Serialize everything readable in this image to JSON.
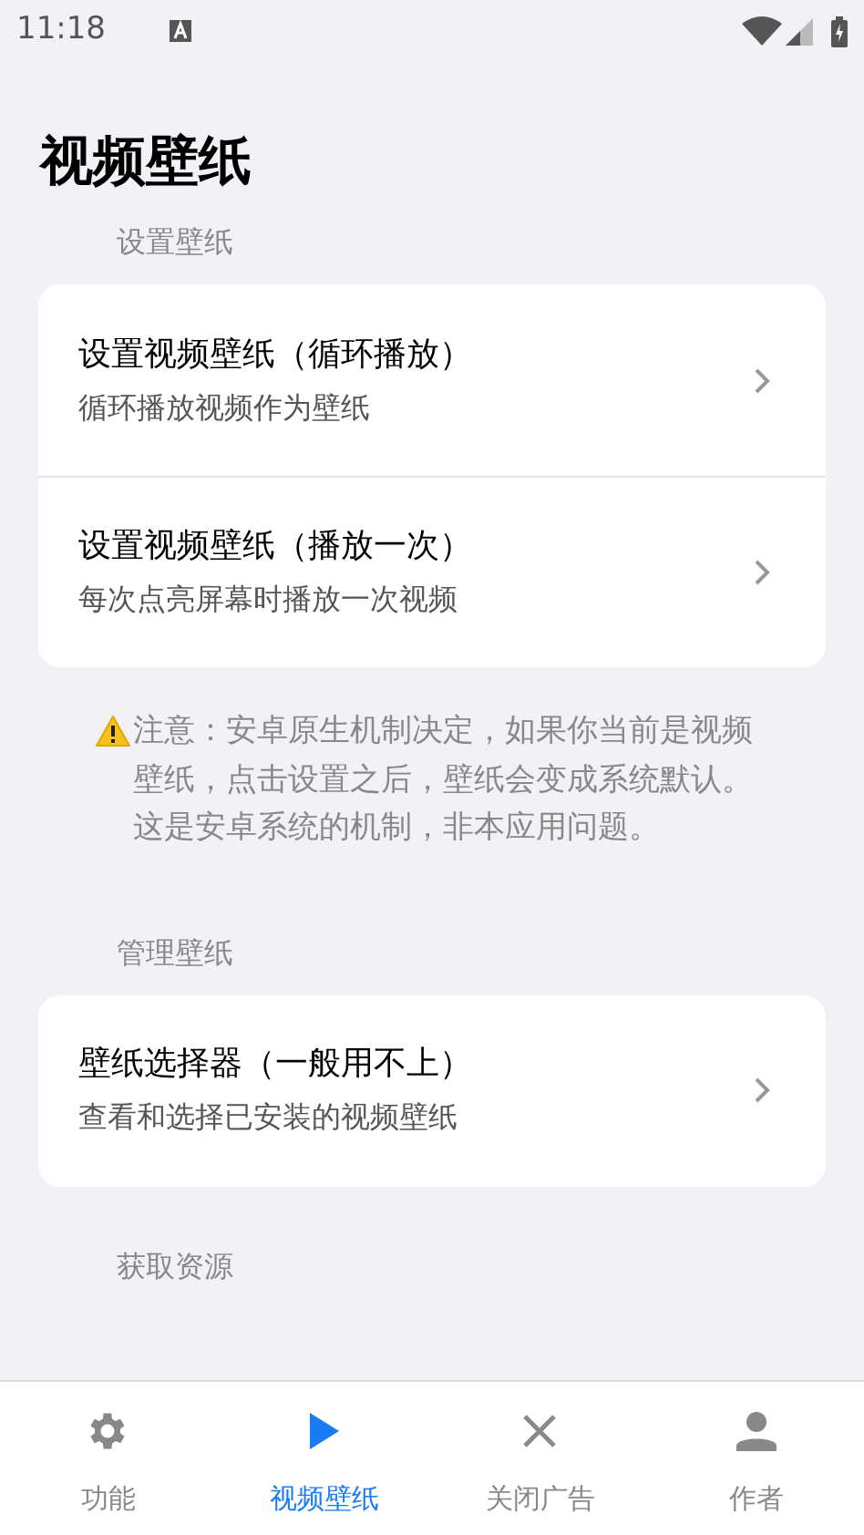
{
  "status_bar": {
    "time": "11:18"
  },
  "title": "视频壁纸",
  "sections": [
    {
      "header": "设置壁纸",
      "items": [
        {
          "title": "设置视频壁纸（循环播放）",
          "subtitle": "循环播放视频作为壁纸"
        },
        {
          "title": "设置视频壁纸（播放一次）",
          "subtitle": "每次点亮屏幕时播放一次视频"
        }
      ],
      "note": "注意：安卓原生机制决定，如果你当前是视频壁纸，点击设置之后，壁纸会变成系统默认。这是安卓系统的机制，非本应用问题。"
    },
    {
      "header": "管理壁纸",
      "items": [
        {
          "title": "壁纸选择器（一般用不上）",
          "subtitle": "查看和选择已安装的视频壁纸"
        }
      ]
    },
    {
      "header": "获取资源"
    }
  ],
  "nav": [
    {
      "label": "功能",
      "kind": "gear",
      "selected": false
    },
    {
      "label": "视频壁纸",
      "kind": "play",
      "selected": true
    },
    {
      "label": "关闭广告",
      "kind": "close",
      "selected": false
    },
    {
      "label": "作者",
      "kind": "person",
      "selected": false
    }
  ]
}
